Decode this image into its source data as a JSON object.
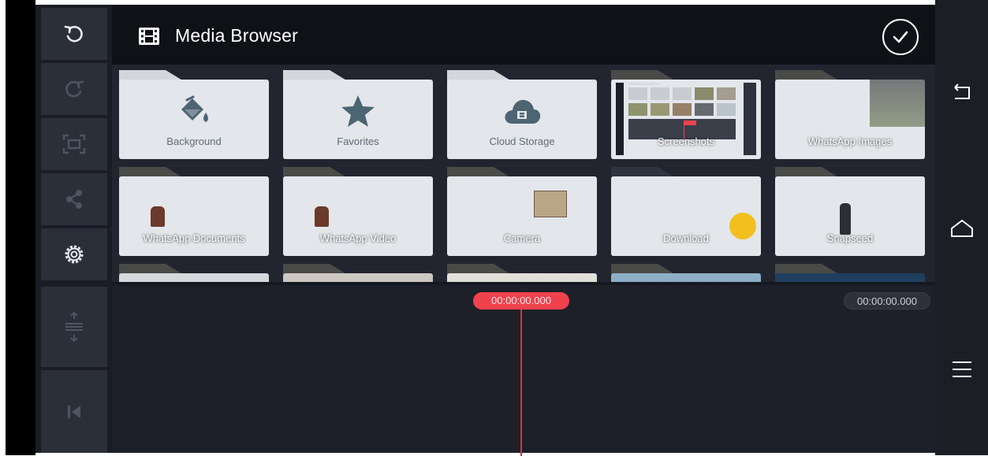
{
  "app": {
    "title": "Media Browser",
    "title_icon": "film-icon",
    "confirm_icon": "check-circle-icon"
  },
  "left_toolbar": [
    {
      "name": "undo",
      "icon": "undo-icon",
      "enabled": true
    },
    {
      "name": "redo",
      "icon": "redo-icon",
      "enabled": false
    },
    {
      "name": "capture",
      "icon": "capture-frame-icon",
      "enabled": false
    },
    {
      "name": "share",
      "icon": "share-icon",
      "enabled": false
    },
    {
      "name": "settings",
      "icon": "gear-icon",
      "enabled": true
    },
    {
      "name": "track-adjust",
      "icon": "track-adjust-icon",
      "enabled": false
    },
    {
      "name": "skip-to-start",
      "icon": "skip-to-start-icon",
      "enabled": false
    }
  ],
  "folders": [
    {
      "label": "Background",
      "icon": "paint-bucket-icon",
      "style": "plain"
    },
    {
      "label": "Favorites",
      "icon": "star-icon",
      "style": "plain"
    },
    {
      "label": "Cloud Storage",
      "icon": "cloud-film-icon",
      "style": "plain"
    },
    {
      "label": "Screenshots",
      "style": "photo"
    },
    {
      "label": "WhatsApp Images",
      "style": "photo"
    },
    {
      "label": "WhatsApp Documents",
      "style": "photo"
    },
    {
      "label": "WhatsApp Video",
      "style": "photo"
    },
    {
      "label": "Camera",
      "style": "photo"
    },
    {
      "label": "Download",
      "style": "dark"
    },
    {
      "label": "Snapseed",
      "style": "photo"
    }
  ],
  "timeline": {
    "current_time": "00:00:00.000",
    "end_time": "00:00:00.000"
  },
  "system_nav": [
    {
      "name": "back",
      "icon": "back-icon"
    },
    {
      "name": "home",
      "icon": "home-icon"
    },
    {
      "name": "menu",
      "icon": "menu-icon"
    }
  ],
  "colors": {
    "accent_red": "#f0424d",
    "header_bg": "#0f1116",
    "panel_bg": "#2b2f3a",
    "folder_light": "#e3e6ea",
    "icon_slate": "#4d6472"
  }
}
